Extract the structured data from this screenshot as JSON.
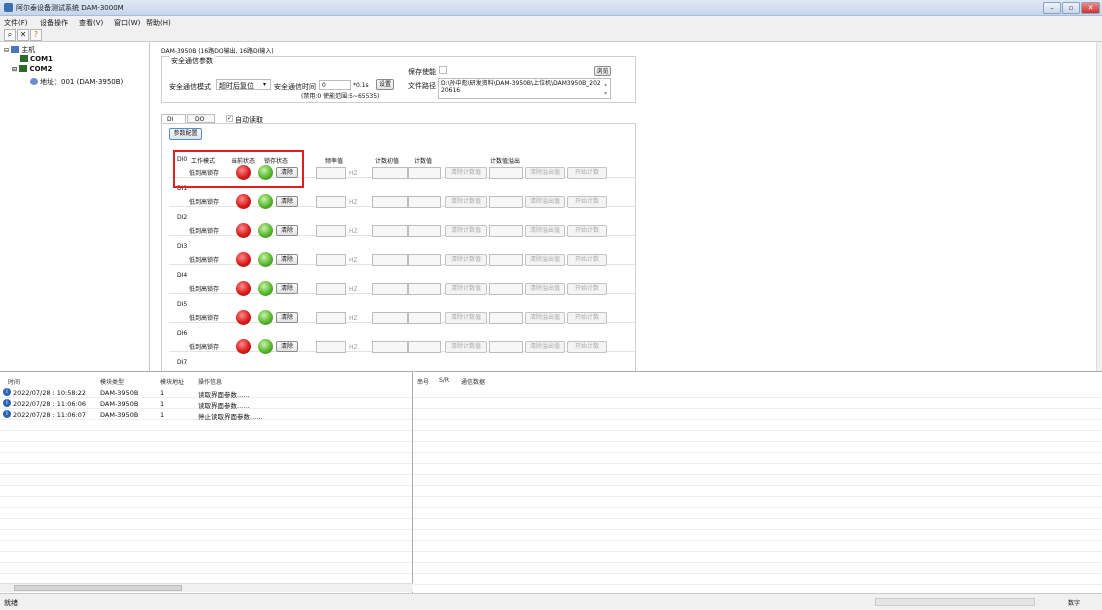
{
  "window": {
    "title": "阿尔泰设备测试系统 DAM-3000M"
  },
  "menu": [
    "文件(F)",
    "设备操作",
    "查看(V)",
    "窗口(W)",
    "帮助(H)"
  ],
  "tree": {
    "root": "主机",
    "com1": "COM1",
    "com2": "COM2",
    "device": "地址：001 (DAM-3950B)"
  },
  "panel": {
    "device_title": "DAM-3950B (16路DO输出, 16路DI输入)",
    "safe_group": "安全通信参数",
    "safe_mode_label": "安全通信模式",
    "safe_mode_value": "超时后复位",
    "safe_time_label": "安全通信时间",
    "safe_time_value": "0",
    "safe_time_unit": "*0.1s",
    "set_button": "设置",
    "range_text": "(禁用:0 使能范围:5~65535)",
    "save_enable_label": "保存使能",
    "browse_button": "浏览",
    "file_path_label": "文件路径",
    "file_path_value": "D:\\孙中彪\\研发资料\\DAM-3950B\\上位机\\DAM3950B_20220616",
    "tab_di": "DI",
    "tab_do": "DO",
    "auto_read_label": "自动读取",
    "param_button": "参数配置",
    "col_mode": "工作模式",
    "col_state": "当前状态",
    "col_latch": "锁存状态",
    "col_freq": "频率值",
    "col_count_init": "计数初值",
    "col_count": "计数值",
    "col_overflow": "计数值溢出",
    "hz": "HZ",
    "clear_button": "清除",
    "clear_count_button": "清除计数值",
    "clear_overflow_button": "清除溢出值",
    "start_count_button": "开始计数",
    "channels": [
      {
        "name": "DI0",
        "mode": "低到高锁存"
      },
      {
        "name": "DI1",
        "mode": "低到高锁存"
      },
      {
        "name": "DI2",
        "mode": "低到高锁存"
      },
      {
        "name": "DI3",
        "mode": "低到高锁存"
      },
      {
        "name": "DI4",
        "mode": "低到高锁存"
      },
      {
        "name": "DI5",
        "mode": "低到高锁存"
      },
      {
        "name": "DI6",
        "mode": "低到高锁存"
      },
      {
        "name": "DI7",
        "mode": ""
      }
    ]
  },
  "log": {
    "headers": [
      "时间",
      "模块类型",
      "模块地址",
      "操作信息"
    ],
    "rows": [
      {
        "time": "2022/07/28 : 10:58:22",
        "type": "DAM-3950B",
        "addr": "1",
        "info": "读取界面参数......"
      },
      {
        "time": "2022/07/28 : 11:06:06",
        "type": "DAM-3950B",
        "addr": "1",
        "info": "读取界面参数......"
      },
      {
        "time": "2022/07/28 : 11:06:07",
        "type": "DAM-3950B",
        "addr": "1",
        "info": "停止读取界面参数......"
      }
    ]
  },
  "comm": {
    "headers": [
      "串号",
      "S/R",
      "通信数据"
    ]
  },
  "status": {
    "ready": "就绪",
    "numlock": "数字"
  },
  "colors": {
    "highlight": "#e02020",
    "led_red": "#d61c1c",
    "led_green": "#57b62e"
  }
}
